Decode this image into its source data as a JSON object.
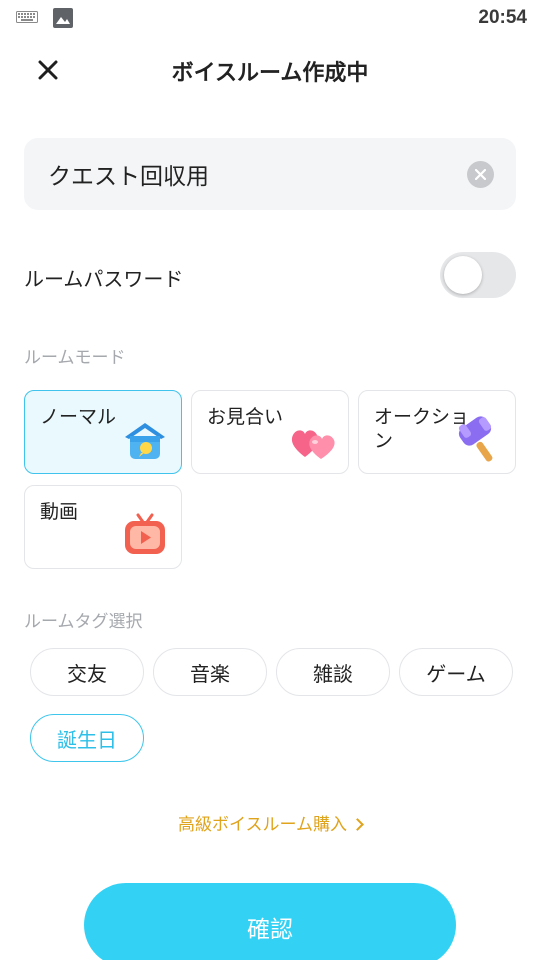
{
  "status_bar": {
    "time": "20:54"
  },
  "header": {
    "title": "ボイスルーム作成中"
  },
  "room_name": {
    "value": "クエスト回収用"
  },
  "password": {
    "label": "ルームパスワード",
    "enabled": false
  },
  "mode_section": {
    "label": "ルームモード",
    "modes": [
      {
        "label": "ノーマル",
        "icon": "house-icon",
        "selected": true
      },
      {
        "label": "お見合い",
        "icon": "hearts-icon",
        "selected": false
      },
      {
        "label": "オークション",
        "icon": "gavel-icon",
        "selected": false
      },
      {
        "label": "動画",
        "icon": "tv-icon",
        "selected": false
      }
    ]
  },
  "tag_section": {
    "label": "ルームタグ選択",
    "tags": [
      {
        "label": "交友",
        "selected": false
      },
      {
        "label": "音楽",
        "selected": false
      },
      {
        "label": "雑談",
        "selected": false
      },
      {
        "label": "ゲーム",
        "selected": false
      },
      {
        "label": "誕生日",
        "selected": true
      }
    ]
  },
  "premium_link": {
    "label": "高級ボイスルーム購入"
  },
  "confirm_button": {
    "label": "確認"
  },
  "colors": {
    "accent": "#33d2f5",
    "tag_selected": "#2cbfe8",
    "premium": "#e0a31c",
    "mode_selected_bg": "#eaf9fd"
  }
}
